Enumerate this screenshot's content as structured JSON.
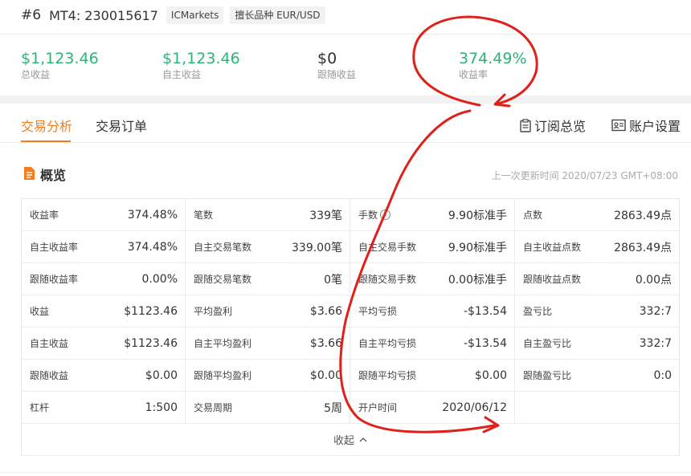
{
  "header": {
    "number": "#6",
    "account": "MT4: 230015617",
    "broker_tag": "ICMarkets",
    "symbol_tag": "擅长品种 EUR/USD"
  },
  "stats": [
    {
      "value": "$1,123.46",
      "label": "总收益"
    },
    {
      "value": "$1,123.46",
      "label": "自主收益"
    },
    {
      "value": "$0",
      "label": "跟随收益"
    },
    {
      "value": "374.49%",
      "label": "收益率"
    }
  ],
  "tabs": [
    "交易分析",
    "交易订单"
  ],
  "actions": {
    "subscribe": "订阅总览",
    "settings": "账户设置"
  },
  "overview": {
    "title": "概览",
    "updated": "上一次更新时间 2020/07/23 GMT+08:00"
  },
  "table": [
    [
      {
        "k": "收益率",
        "v": "374.48%"
      },
      {
        "k": "笔数",
        "v": "339笔"
      },
      {
        "k": "手数",
        "v": "9.90标准手"
      },
      {
        "k": "点数",
        "v": "2863.49点"
      }
    ],
    [
      {
        "k": "自主收益率",
        "v": "374.48%"
      },
      {
        "k": "自主交易笔数",
        "v": "339.00笔"
      },
      {
        "k": "自主交易手数",
        "v": "9.90标准手"
      },
      {
        "k": "自主收益点数",
        "v": "2863.49点"
      }
    ],
    [
      {
        "k": "跟随收益率",
        "v": "0.00%"
      },
      {
        "k": "跟随交易笔数",
        "v": "0笔"
      },
      {
        "k": "跟随交易手数",
        "v": "0.00标准手"
      },
      {
        "k": "跟随收益点数",
        "v": "0.00点"
      }
    ],
    [
      {
        "k": "收益",
        "v": "$1123.46"
      },
      {
        "k": "平均盈利",
        "v": "$3.66"
      },
      {
        "k": "平均亏损",
        "v": "-$13.54"
      },
      {
        "k": "盈亏比",
        "v": "332:7"
      }
    ],
    [
      {
        "k": "自主收益",
        "v": "$1123.46"
      },
      {
        "k": "自主平均盈利",
        "v": "$3.66"
      },
      {
        "k": "自主平均亏损",
        "v": "-$13.54"
      },
      {
        "k": "自主盈亏比",
        "v": "332:7"
      }
    ],
    [
      {
        "k": "跟随收益",
        "v": "$0.00"
      },
      {
        "k": "跟随平均盈利",
        "v": "$0.00"
      },
      {
        "k": "跟随平均亏损",
        "v": "$0.00"
      },
      {
        "k": "跟随盈亏比",
        "v": "0:0"
      }
    ],
    [
      {
        "k": "杠杆",
        "v": "1:500"
      },
      {
        "k": "交易周期",
        "v": "5周"
      },
      {
        "k": "开户时间",
        "v": "2020/06/12"
      },
      {
        "k": "",
        "v": ""
      }
    ]
  ],
  "collapse_label": "收起",
  "info_glyph": "i",
  "colors": {
    "positive": "#2bb37c",
    "accent": "#f57c1f",
    "annotation": "#e0201a"
  }
}
